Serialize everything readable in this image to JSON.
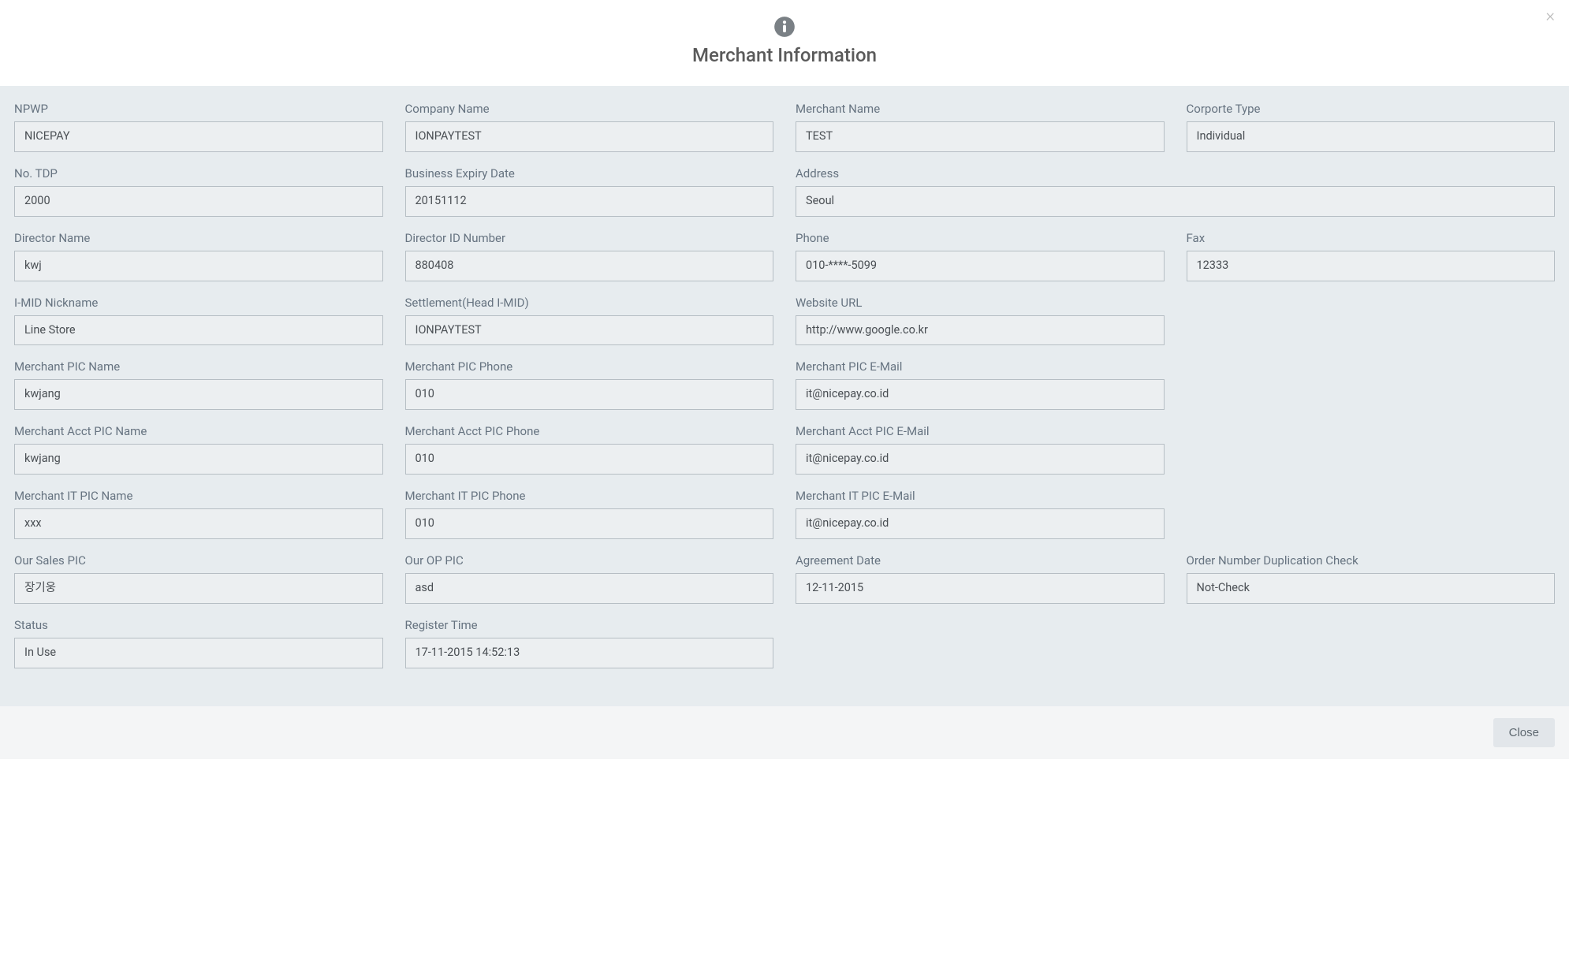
{
  "header": {
    "title": "Merchant Information",
    "close_x": "×"
  },
  "rows": [
    [
      {
        "w": 3,
        "id": "npwp",
        "label": "NPWP",
        "value": "NICEPAY"
      },
      {
        "w": 3,
        "id": "company-name",
        "label": "Company Name",
        "value": "IONPAYTEST"
      },
      {
        "w": 3,
        "id": "merchant-name",
        "label": "Merchant Name",
        "value": "TEST"
      },
      {
        "w": 3,
        "id": "corporate-type",
        "label": "Corporte Type",
        "value": "Individual"
      }
    ],
    [
      {
        "w": 3,
        "id": "no-tdp",
        "label": "No. TDP",
        "value": "2000"
      },
      {
        "w": 3,
        "id": "business-expiry-date",
        "label": "Business Expiry Date",
        "value": "20151112"
      },
      {
        "w": 6,
        "id": "address",
        "label": "Address",
        "value": "Seoul"
      }
    ],
    [
      {
        "w": 3,
        "id": "director-name",
        "label": "Director Name",
        "value": "kwj"
      },
      {
        "w": 3,
        "id": "director-id-number",
        "label": "Director ID Number",
        "value": "880408"
      },
      {
        "w": 3,
        "id": "phone",
        "label": "Phone",
        "value": "010-****-5099"
      },
      {
        "w": 3,
        "id": "fax",
        "label": "Fax",
        "value": "12333"
      }
    ],
    [
      {
        "w": 3,
        "id": "imid-nickname",
        "label": "I-MID Nickname",
        "value": "Line Store"
      },
      {
        "w": 3,
        "id": "settlement-head-imid",
        "label": "Settlement(Head I-MID)",
        "value": "IONPAYTEST"
      },
      {
        "w": 3,
        "id": "website-url",
        "label": "Website URL",
        "value": "http://www.google.co.kr"
      }
    ],
    [
      {
        "w": 3,
        "id": "merchant-pic-name",
        "label": "Merchant PIC Name",
        "value": "kwjang"
      },
      {
        "w": 3,
        "id": "merchant-pic-phone",
        "label": "Merchant PIC Phone",
        "value": "010"
      },
      {
        "w": 3,
        "id": "merchant-pic-email",
        "label": "Merchant PIC E-Mail",
        "value": "it@nicepay.co.id"
      }
    ],
    [
      {
        "w": 3,
        "id": "merchant-acct-pic-name",
        "label": "Merchant Acct PIC Name",
        "value": "kwjang"
      },
      {
        "w": 3,
        "id": "merchant-acct-pic-phone",
        "label": "Merchant Acct PIC Phone",
        "value": "010"
      },
      {
        "w": 3,
        "id": "merchant-acct-pic-email",
        "label": "Merchant Acct PIC E-Mail",
        "value": "it@nicepay.co.id"
      }
    ],
    [
      {
        "w": 3,
        "id": "merchant-it-pic-name",
        "label": "Merchant IT PIC Name",
        "value": "xxx"
      },
      {
        "w": 3,
        "id": "merchant-it-pic-phone",
        "label": "Merchant IT PIC Phone",
        "value": "010"
      },
      {
        "w": 3,
        "id": "merchant-it-pic-email",
        "label": "Merchant IT PIC E-Mail",
        "value": "it@nicepay.co.id"
      }
    ],
    [
      {
        "w": 3,
        "id": "our-sales-pic",
        "label": "Our Sales PIC",
        "value": "장기웅"
      },
      {
        "w": 3,
        "id": "our-op-pic",
        "label": "Our OP PIC",
        "value": "asd"
      },
      {
        "w": 3,
        "id": "agreement-date",
        "label": "Agreement Date",
        "value": "12-11-2015"
      },
      {
        "w": 3,
        "id": "order-number-dup-check",
        "label": "Order Number Duplication Check",
        "value": "Not-Check"
      }
    ],
    [
      {
        "w": 3,
        "id": "status",
        "label": "Status",
        "value": "In Use"
      },
      {
        "w": 3,
        "id": "register-time",
        "label": "Register Time",
        "value": "17-11-2015 14:52:13"
      }
    ]
  ],
  "footer": {
    "close_label": "Close"
  }
}
